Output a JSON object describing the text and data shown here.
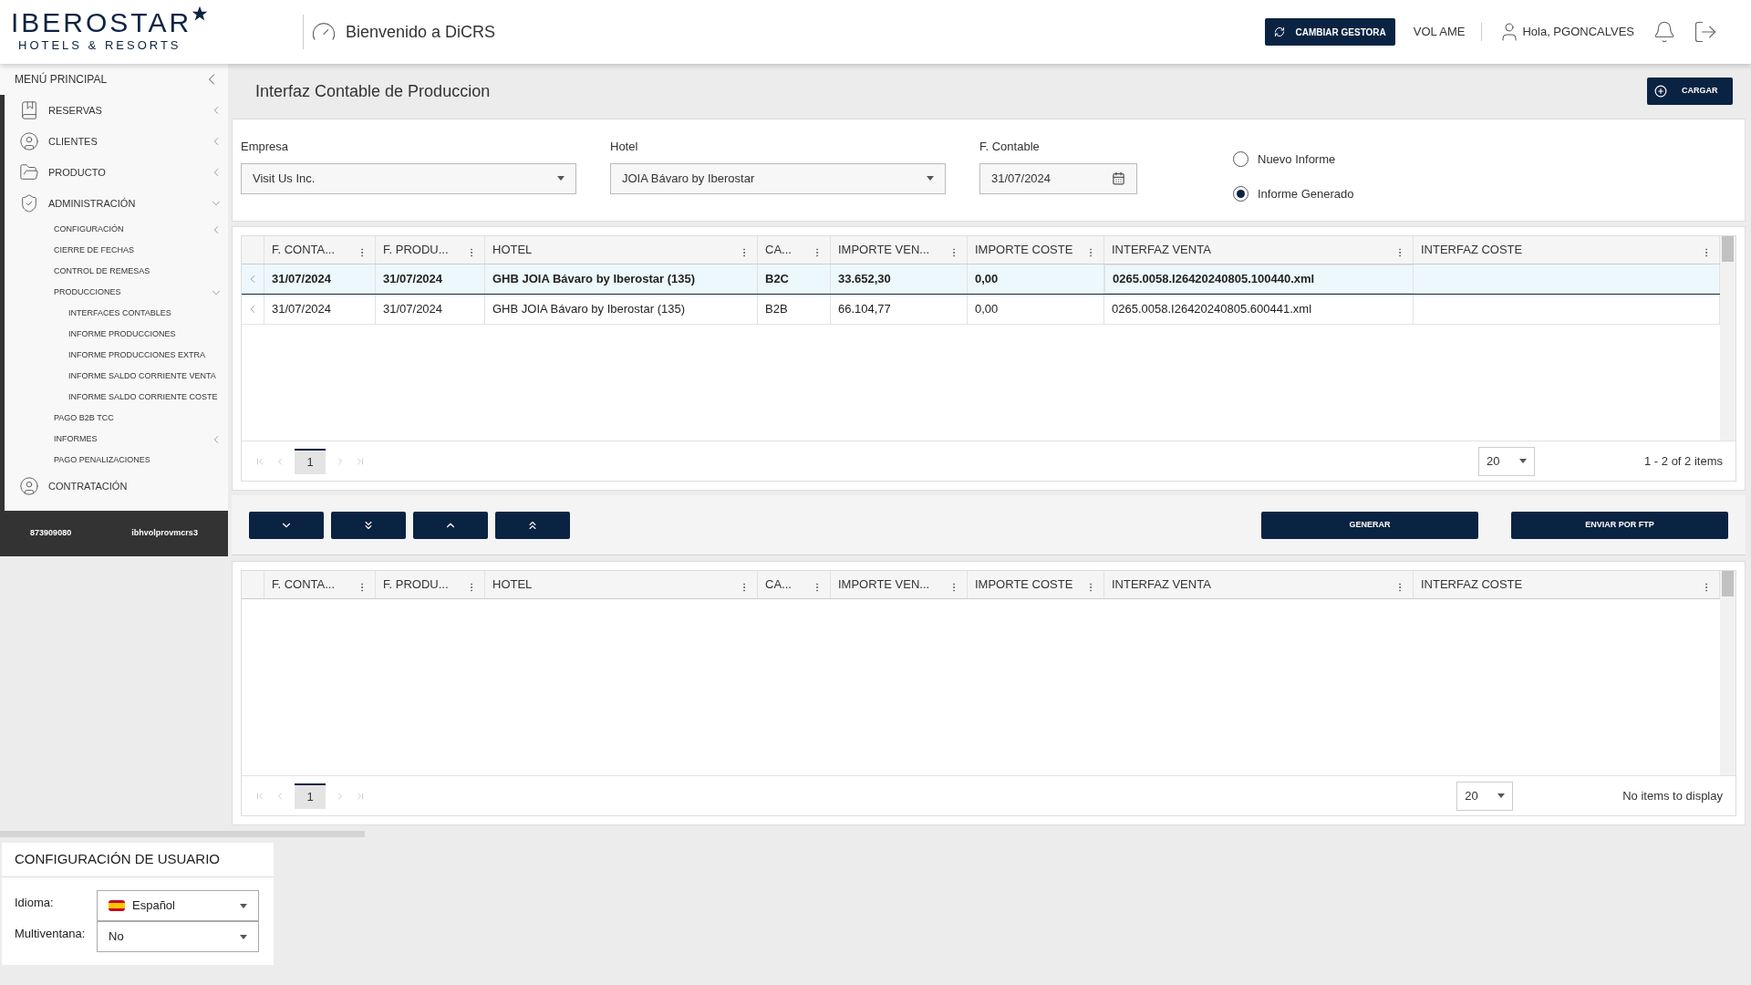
{
  "header": {
    "brand": "IBEROSTAR",
    "tagline": "HOTELS & RESORTS",
    "welcome": "Bienvenido a DiCRS",
    "change_button": "CAMBIAR GESTORA",
    "office": "VOL AME",
    "greeting": "Hola, PGONCALVES"
  },
  "sidebar": {
    "title": "MENÚ PRINCIPAL",
    "items": [
      {
        "label": "RESERVAS",
        "expanded": false
      },
      {
        "label": "CLIENTES",
        "expanded": false
      },
      {
        "label": "PRODUCTO",
        "expanded": false
      },
      {
        "label": "ADMINISTRACIÓN",
        "expanded": true,
        "children": [
          {
            "label": "CONFIGURACIÓN",
            "expanded": false
          },
          {
            "label": "CIERRE DE FECHAS"
          },
          {
            "label": "CONTROL DE REMESAS"
          },
          {
            "label": "PRODUCCIONES",
            "expanded": true,
            "children": [
              {
                "label": "INTERFACES CONTABLES"
              },
              {
                "label": "INFORME PRODUCCIONES"
              },
              {
                "label": "INFORME PRODUCCIONES EXTRA"
              },
              {
                "label": "INFORME SALDO CORRIENTE VENTA"
              },
              {
                "label": "INFORME SALDO CORRIENTE COSTE"
              }
            ]
          },
          {
            "label": "PAGO B2B TCC"
          },
          {
            "label": "INFORMES",
            "expanded": false
          },
          {
            "label": "PAGO PENALIZACIONES"
          }
        ]
      },
      {
        "label": "CONTRATACIÓN"
      }
    ],
    "footer": [
      "873909080",
      "ibhvolprovmcrs3"
    ]
  },
  "page": {
    "title": "Interfaz Contable de Produccion",
    "load_button": "CARGAR"
  },
  "form": {
    "company": {
      "label": "Empresa",
      "value": "Visit Us Inc."
    },
    "hotel": {
      "label": "Hotel",
      "value": "JOIA Bávaro by Iberostar"
    },
    "date": {
      "label": "F. Contable",
      "value": "31/07/2024"
    },
    "radios": [
      {
        "label": "Nuevo Informe",
        "selected": false
      },
      {
        "label": "Informe Generado",
        "selected": true
      }
    ]
  },
  "tables": [
    {
      "columns": [
        "F. CONTA...",
        "F. PRODU...",
        "HOTEL",
        "CA...",
        "IMPORTE VEN...",
        "IMPORTE COSTE",
        "INTERFAZ VENTA",
        "INTERFAZ COSTE"
      ],
      "rows": [
        {
          "selected": true,
          "cells": [
            "31/07/2024",
            "31/07/2024",
            "GHB JOIA Bávaro by Iberostar (135)",
            "B2C",
            "33.652,30",
            "0,00",
            "0265.0058.I26420240805.100440.xml"
          ]
        },
        {
          "selected": false,
          "cells": [
            "31/07/2024",
            "31/07/2024",
            "GHB JOIA Bávaro by Iberostar (135)",
            "B2B",
            "66.104,77",
            "0,00",
            "0265.0058.I26420240805.600441.xml"
          ]
        }
      ],
      "page": "1",
      "page_size": "20",
      "summary": "1 - 2 of 2 items"
    },
    {
      "columns": [
        "F. CONTA...",
        "F. PRODU...",
        "HOTEL",
        "CA...",
        "IMPORTE VEN...",
        "IMPORTE COSTE",
        "INTERFAZ VENTA",
        "INTERFAZ COSTE"
      ],
      "page": "1",
      "page_size": "20",
      "summary": "No items to display"
    }
  ],
  "actions": {
    "generate": "GENERAR",
    "ftp": "ENVIAR POR FTP"
  },
  "user_config": {
    "title": "CONFIGURACIÓN DE USUARIO",
    "fields": [
      {
        "kind": "language",
        "label": "Idioma:",
        "value": "Español"
      },
      {
        "kind": "plain",
        "label": "Multiventana:",
        "value": "No"
      }
    ]
  }
}
